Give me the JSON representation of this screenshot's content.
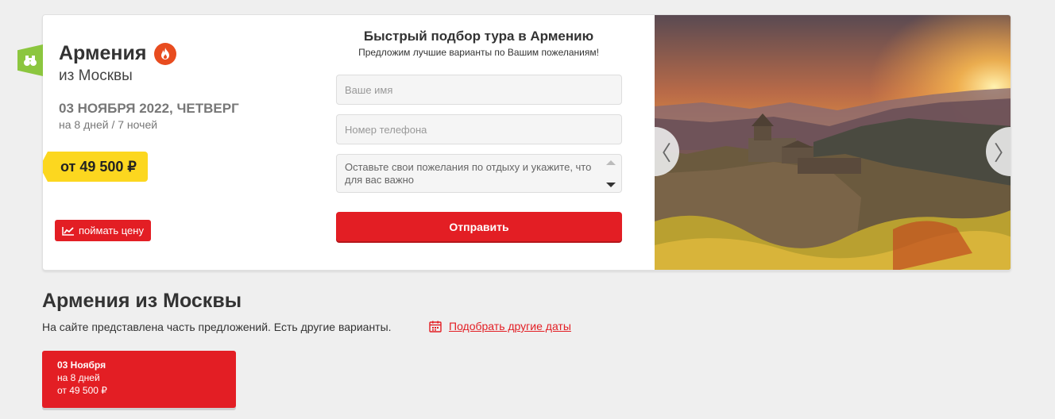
{
  "colors": {
    "accent": "#e31e24",
    "price": "#fcd71f",
    "tag": "#8cc63f",
    "fire": "#e84c1f"
  },
  "tour": {
    "country": "Армения",
    "from": "из Москвы",
    "date": "03 НОЯБРЯ 2022, ЧЕТВЕРГ",
    "duration": "на 8 дней / 7 ночей",
    "price": "от 49 500 ₽",
    "catch_price_label": "поймать цену",
    "tag_icon": "binoculars-icon",
    "hot_icon": "fire-icon"
  },
  "form": {
    "title": "Быстрый подбор тура в Армению",
    "subtitle": "Предложим лучшие варианты по Вашим пожеланиям!",
    "name_placeholder": "Ваше имя",
    "phone_placeholder": "Номер телефона",
    "wishes_placeholder": "Оставьте свои пожелания по отдыху и укажите, что для вас важно",
    "submit_label": "Отправить"
  },
  "slider": {
    "prev_label": "〈",
    "next_label": "〉"
  },
  "section": {
    "title": "Армения из Москвы",
    "description": "На сайте представлена часть предложений. Есть другие варианты.",
    "other_dates_label": "Подобрать другие даты",
    "calendar_icon": "calendar-icon"
  },
  "date_cards": [
    {
      "date": "03 Ноября",
      "duration": "на 8 дней",
      "price": "от 49 500 ₽"
    }
  ]
}
